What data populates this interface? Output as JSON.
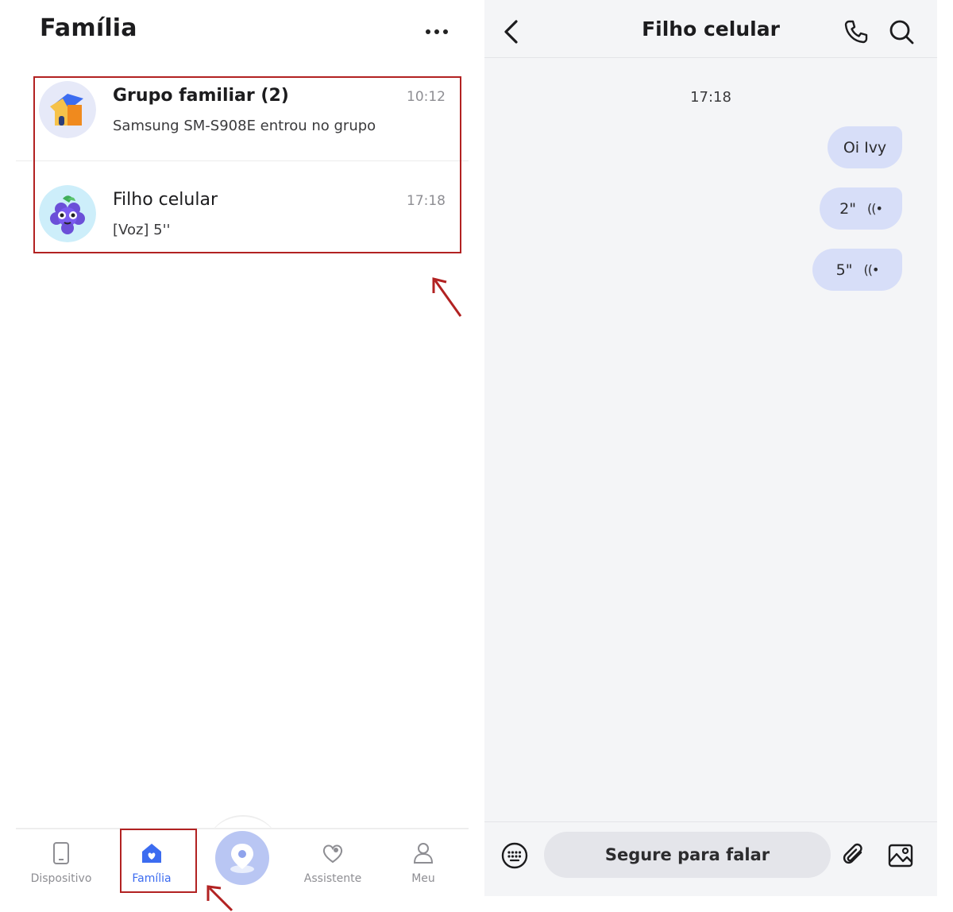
{
  "left": {
    "page_title": "Família",
    "more_icon": "more-dots-icon",
    "chats": [
      {
        "name": "Grupo familiar (2)",
        "time": "10:12",
        "preview": "Samsung SM-S908E entrou no grupo",
        "avatar_icon": "house-icon"
      },
      {
        "name": "Filho celular",
        "time": "17:18",
        "preview": "[Voz] 5''",
        "avatar_icon": "grape-icon"
      }
    ],
    "nav": {
      "items": [
        {
          "label": "Dispositivo",
          "icon": "device-icon"
        },
        {
          "label": "Família",
          "icon": "family-home-icon",
          "active": true
        },
        {
          "label": "",
          "icon": "location-pin-icon"
        },
        {
          "label": "Assistente",
          "icon": "heart-icon"
        },
        {
          "label": "Meu",
          "icon": "user-icon"
        }
      ]
    }
  },
  "right": {
    "header": {
      "title": "Filho celular",
      "back_icon": "back-chevron-icon",
      "call_icon": "phone-icon",
      "search_icon": "search-icon"
    },
    "timestamp": "17:18",
    "messages": [
      {
        "text": "Oi Ivy",
        "type": "text"
      },
      {
        "text": "2\"",
        "type": "voice",
        "wave": "((•"
      },
      {
        "text": "5\"",
        "type": "voice",
        "wave": "((•"
      }
    ],
    "input": {
      "hold_to_talk": "Segure para falar",
      "keyboard_icon": "keyboard-icon",
      "attach_icon": "paperclip-icon",
      "image_icon": "image-icon"
    }
  },
  "colors": {
    "accent": "#3c6cf0",
    "annotation": "#b22222",
    "bubble": "#d7def8",
    "panel_bg": "#f4f5f7"
  }
}
